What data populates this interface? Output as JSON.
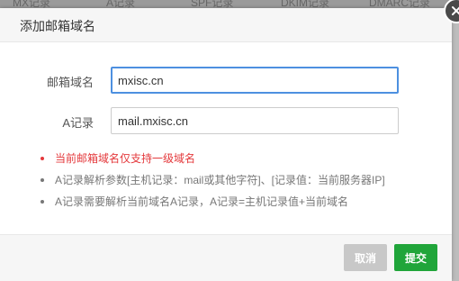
{
  "background": {
    "columns": [
      "MX记录",
      "A记录",
      "SPF记录",
      "DKIM记录",
      "DMARC记录"
    ]
  },
  "dialog": {
    "title": "添加邮箱域名",
    "fields": {
      "domain": {
        "label": "邮箱域名",
        "value": "mxisc.cn"
      },
      "a_record": {
        "label": "A记录",
        "value": "mail.mxisc.cn"
      }
    },
    "tips": [
      "当前邮箱域名仅支持一级域名",
      "A记录解析参数[主机记录：mail或其他字符]、[记录值：当前服务器IP]",
      "A记录需要解析当前域名A记录，A记录=主机记录值+当前域名"
    ],
    "buttons": {
      "cancel": "取消",
      "submit": "提交"
    }
  },
  "colors": {
    "submit": "#20a53a",
    "cancel": "#c8c8c8",
    "warning": "#e4393c",
    "focus_border": "#4d90e0"
  },
  "icons": {
    "close": "close-icon"
  }
}
